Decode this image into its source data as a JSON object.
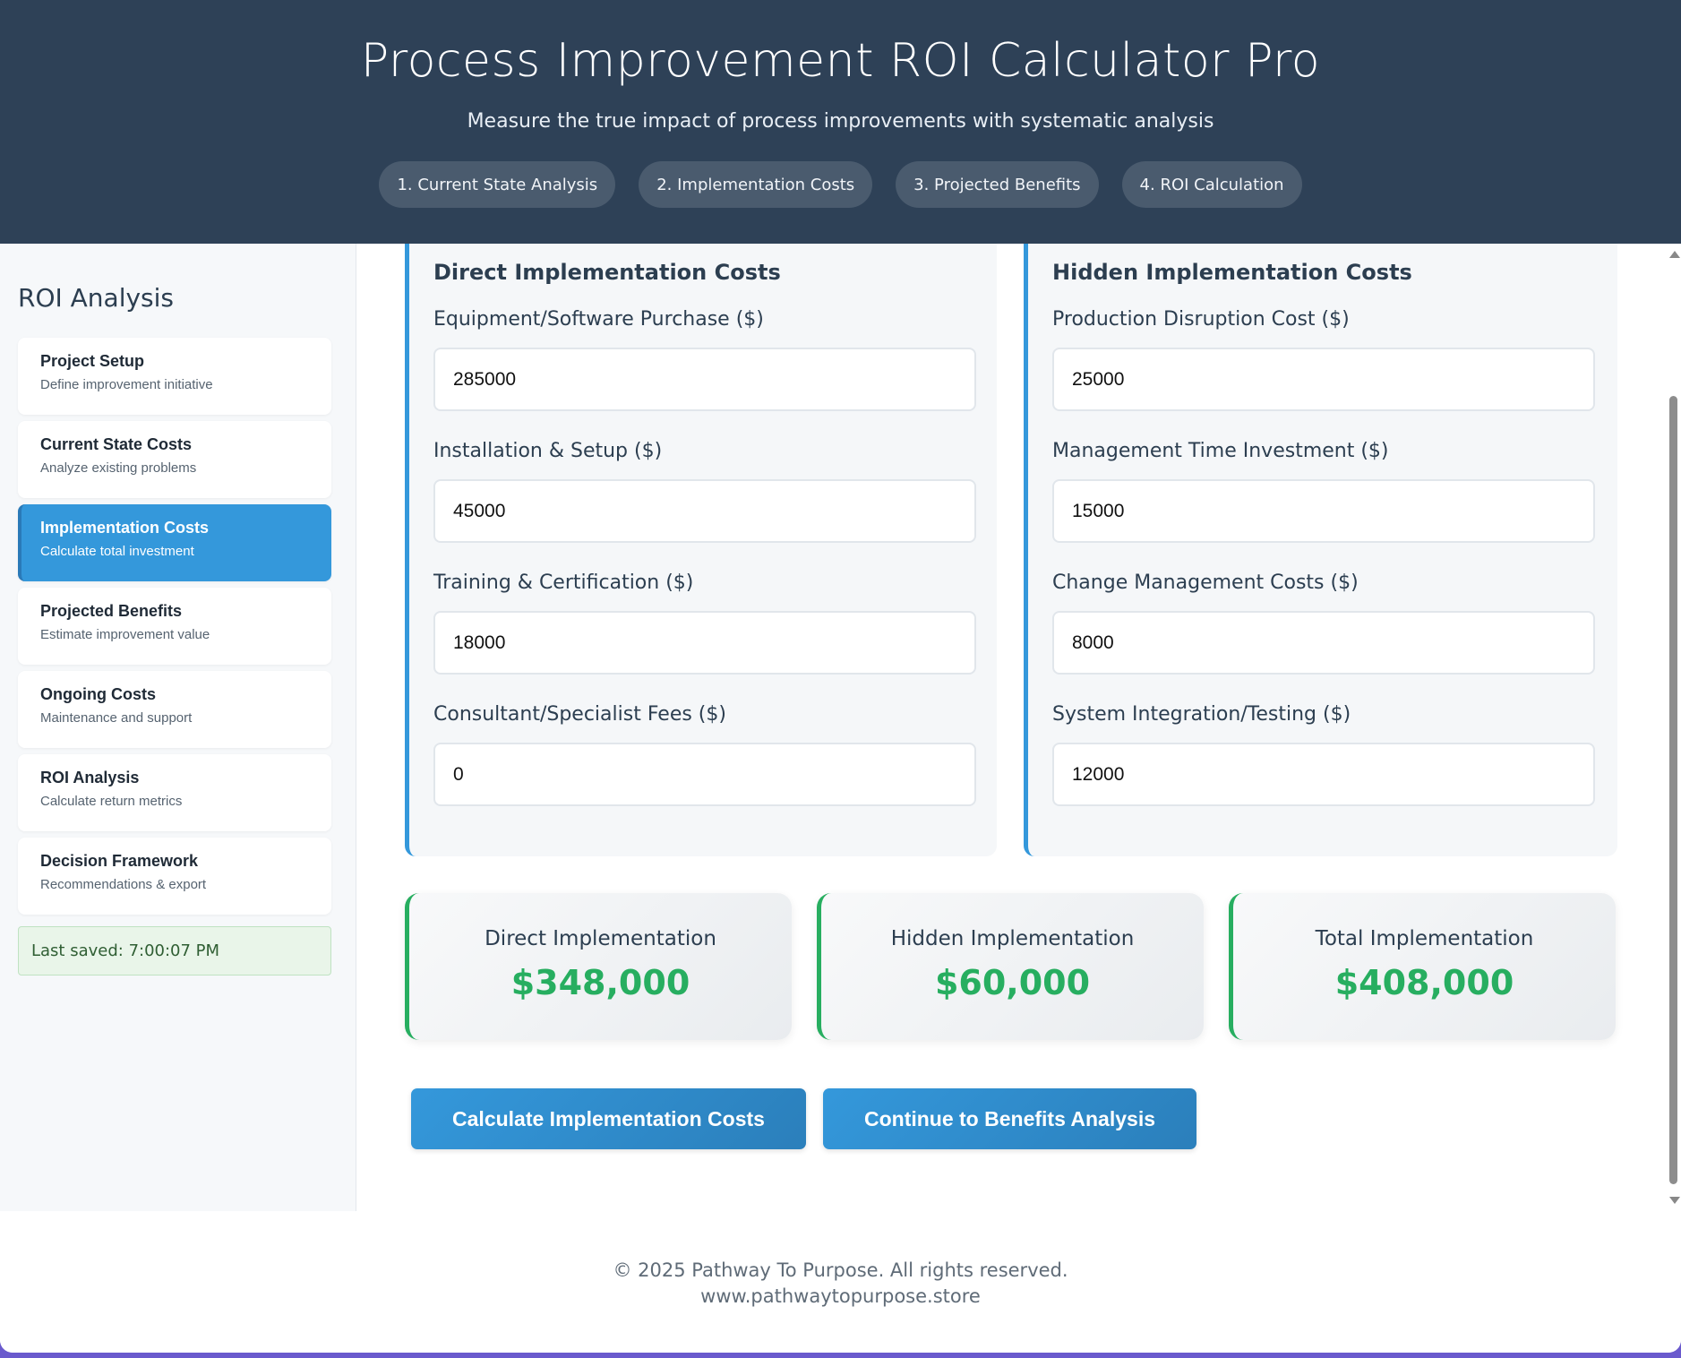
{
  "header": {
    "title": "Process Improvement ROI Calculator Pro",
    "subtitle": "Measure the true impact of process improvements with systematic analysis",
    "steps": [
      "1. Current State Analysis",
      "2. Implementation Costs",
      "3. Projected Benefits",
      "4. ROI Calculation"
    ]
  },
  "sidebar": {
    "title": "ROI Analysis",
    "items": [
      {
        "title": "Project Setup",
        "desc": "Define improvement initiative"
      },
      {
        "title": "Current State Costs",
        "desc": "Analyze existing problems"
      },
      {
        "title": "Implementation Costs",
        "desc": "Calculate total investment",
        "active": true
      },
      {
        "title": "Projected Benefits",
        "desc": "Estimate improvement value"
      },
      {
        "title": "Ongoing Costs",
        "desc": "Maintenance and support"
      },
      {
        "title": "ROI Analysis",
        "desc": "Calculate return metrics"
      },
      {
        "title": "Decision Framework",
        "desc": "Recommendations & export"
      }
    ],
    "last_saved": "Last saved: 7:00:07 PM"
  },
  "direct": {
    "title": "Direct Implementation Costs",
    "fields": [
      {
        "label": "Equipment/Software Purchase ($)",
        "value": "285000"
      },
      {
        "label": "Installation & Setup ($)",
        "value": "45000"
      },
      {
        "label": "Training & Certification ($)",
        "value": "18000"
      },
      {
        "label": "Consultant/Specialist Fees ($)",
        "value": "0"
      }
    ]
  },
  "hidden": {
    "title": "Hidden Implementation Costs",
    "fields": [
      {
        "label": "Production Disruption Cost ($)",
        "value": "25000"
      },
      {
        "label": "Management Time Investment ($)",
        "value": "15000"
      },
      {
        "label": "Change Management Costs ($)",
        "value": "8000"
      },
      {
        "label": "System Integration/Testing ($)",
        "value": "12000"
      }
    ]
  },
  "summary": [
    {
      "label": "Direct Implementation",
      "value": "$348,000"
    },
    {
      "label": "Hidden Implementation",
      "value": "$60,000"
    },
    {
      "label": "Total Implementation",
      "value": "$408,000"
    }
  ],
  "buttons": {
    "calculate": "Calculate Implementation Costs",
    "continue": "Continue to Benefits Analysis"
  },
  "footer": {
    "copyright": "© 2025 Pathway To Purpose. All rights reserved.",
    "website": "www.pathwaytopurpose.store"
  },
  "colors": {
    "header_bg": "#2e4157",
    "accent_blue": "#3498db",
    "success_green": "#27ae60"
  }
}
